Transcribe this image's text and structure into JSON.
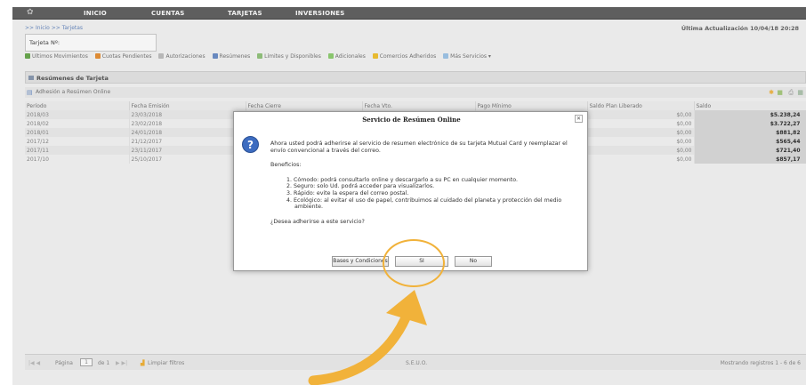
{
  "nav": {
    "items": [
      "INICIO",
      "CUENTAS",
      "TARJETAS",
      "INVERSIONES"
    ]
  },
  "breadcrumb": ">> Inicio >> Tarjetas",
  "last_update": "Última Actualización 10/04/18 20:28",
  "card_tab_title": "Tarjeta Nº:",
  "toolbar": {
    "items": [
      "Últimos Movimientos",
      "Cuotas Pendientes",
      "Autorizaciones",
      "Resúmenes",
      "Límites y Disponibles",
      "Adicionales",
      "Comercios Adheridos",
      "Más Servicios"
    ]
  },
  "panel_title": "Resúmenes de Tarjeta",
  "subbar_label": "Adhesión a Resúmen Online",
  "table": {
    "columns": [
      "Período",
      "Fecha Emisión",
      "Fecha Cierre",
      "Fecha Vto.",
      "Pago Mínimo",
      "Saldo Plan Liberado",
      "Saldo"
    ],
    "rows": [
      [
        "2018/03",
        "23/03/2018",
        "$0,00",
        "$5.238,24"
      ],
      [
        "2018/02",
        "23/02/2018",
        "$0,00",
        "$3.722,27"
      ],
      [
        "2018/01",
        "24/01/2018",
        "$0,00",
        "$881,82"
      ],
      [
        "2017/12",
        "21/12/2017",
        "$0,00",
        "$565,44"
      ],
      [
        "2017/11",
        "23/11/2017",
        "$0,00",
        "$721,40"
      ],
      [
        "2017/10",
        "25/10/2017",
        "$0,00",
        "$857,17"
      ]
    ]
  },
  "footer": {
    "page_label": "Página",
    "page_value": "1",
    "of_label": "de 1",
    "clear_filters": "Limpiar filtros",
    "center": "S.E.U.O.",
    "records": "Mostrando registros 1 - 6 de 6"
  },
  "dialog": {
    "title": "Servicio de Resúmen Online",
    "intro": "Ahora usted podrá adherirse al servicio de resumen electrónico de su tarjeta Mutual Card y reemplazar el envío convencional a través del correo.",
    "benefits_label": "Beneficios:",
    "benefits": [
      "1. Cómodo: podrá consultarlo online y descargarlo a su PC en cualquier momento.",
      "2. Seguro: solo Ud. podrá acceder para visualizarlos.",
      "3. Rápido: evite la espera del correo postal.",
      "4. Ecológico: al evitar el uso de papel, contribuimos al cuidado del planeta y protección del medio ambiente."
    ],
    "question": "¿Desea adherirse a este servicio?",
    "buttons": {
      "terms": "Bases y Condiciones",
      "yes": "SI",
      "no": "No"
    }
  },
  "colors": {
    "nav_bg": "#5e5e5e",
    "highlight": "#f1b23a",
    "question_icon": "#3d6cc0"
  }
}
